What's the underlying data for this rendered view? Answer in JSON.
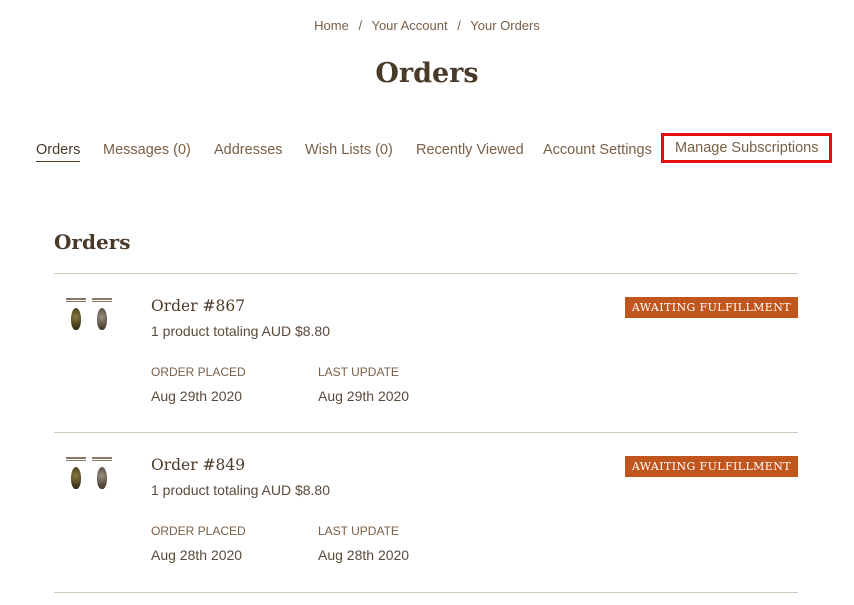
{
  "breadcrumb": {
    "items": [
      "Home",
      "Your Account",
      "Your Orders"
    ],
    "separator": "/"
  },
  "page_title": "Orders",
  "account_nav": {
    "items": [
      {
        "label": "Orders",
        "active": true
      },
      {
        "label": "Messages (0)"
      },
      {
        "label": "Addresses"
      },
      {
        "label": "Wish Lists (0)"
      },
      {
        "label": "Recently Viewed"
      },
      {
        "label": "Account Settings"
      },
      {
        "label": "Manage Subscriptions",
        "highlighted": true
      }
    ]
  },
  "orders_section": {
    "title": "Orders",
    "placed_label": "ORDER PLACED",
    "update_label": "LAST UPDATE",
    "orders": [
      {
        "number": "Order #867",
        "summary": "1 product totaling AUD $8.80",
        "status": "AWAITING FULFILLMENT",
        "placed": "Aug 29th 2020",
        "updated": "Aug 29th 2020"
      },
      {
        "number": "Order #849",
        "summary": "1 product totaling AUD $8.80",
        "status": "AWAITING FULFILLMENT",
        "placed": "Aug 28th 2020",
        "updated": "Aug 28th 2020"
      }
    ]
  },
  "colors": {
    "status_badge": "#c0561e",
    "highlight_box": "#e01010",
    "text_brown": "#7a6048",
    "heading": "#4a3a2a"
  },
  "icons": {
    "product_thumbnail": "cannabis-product-thumbnail-icon"
  }
}
